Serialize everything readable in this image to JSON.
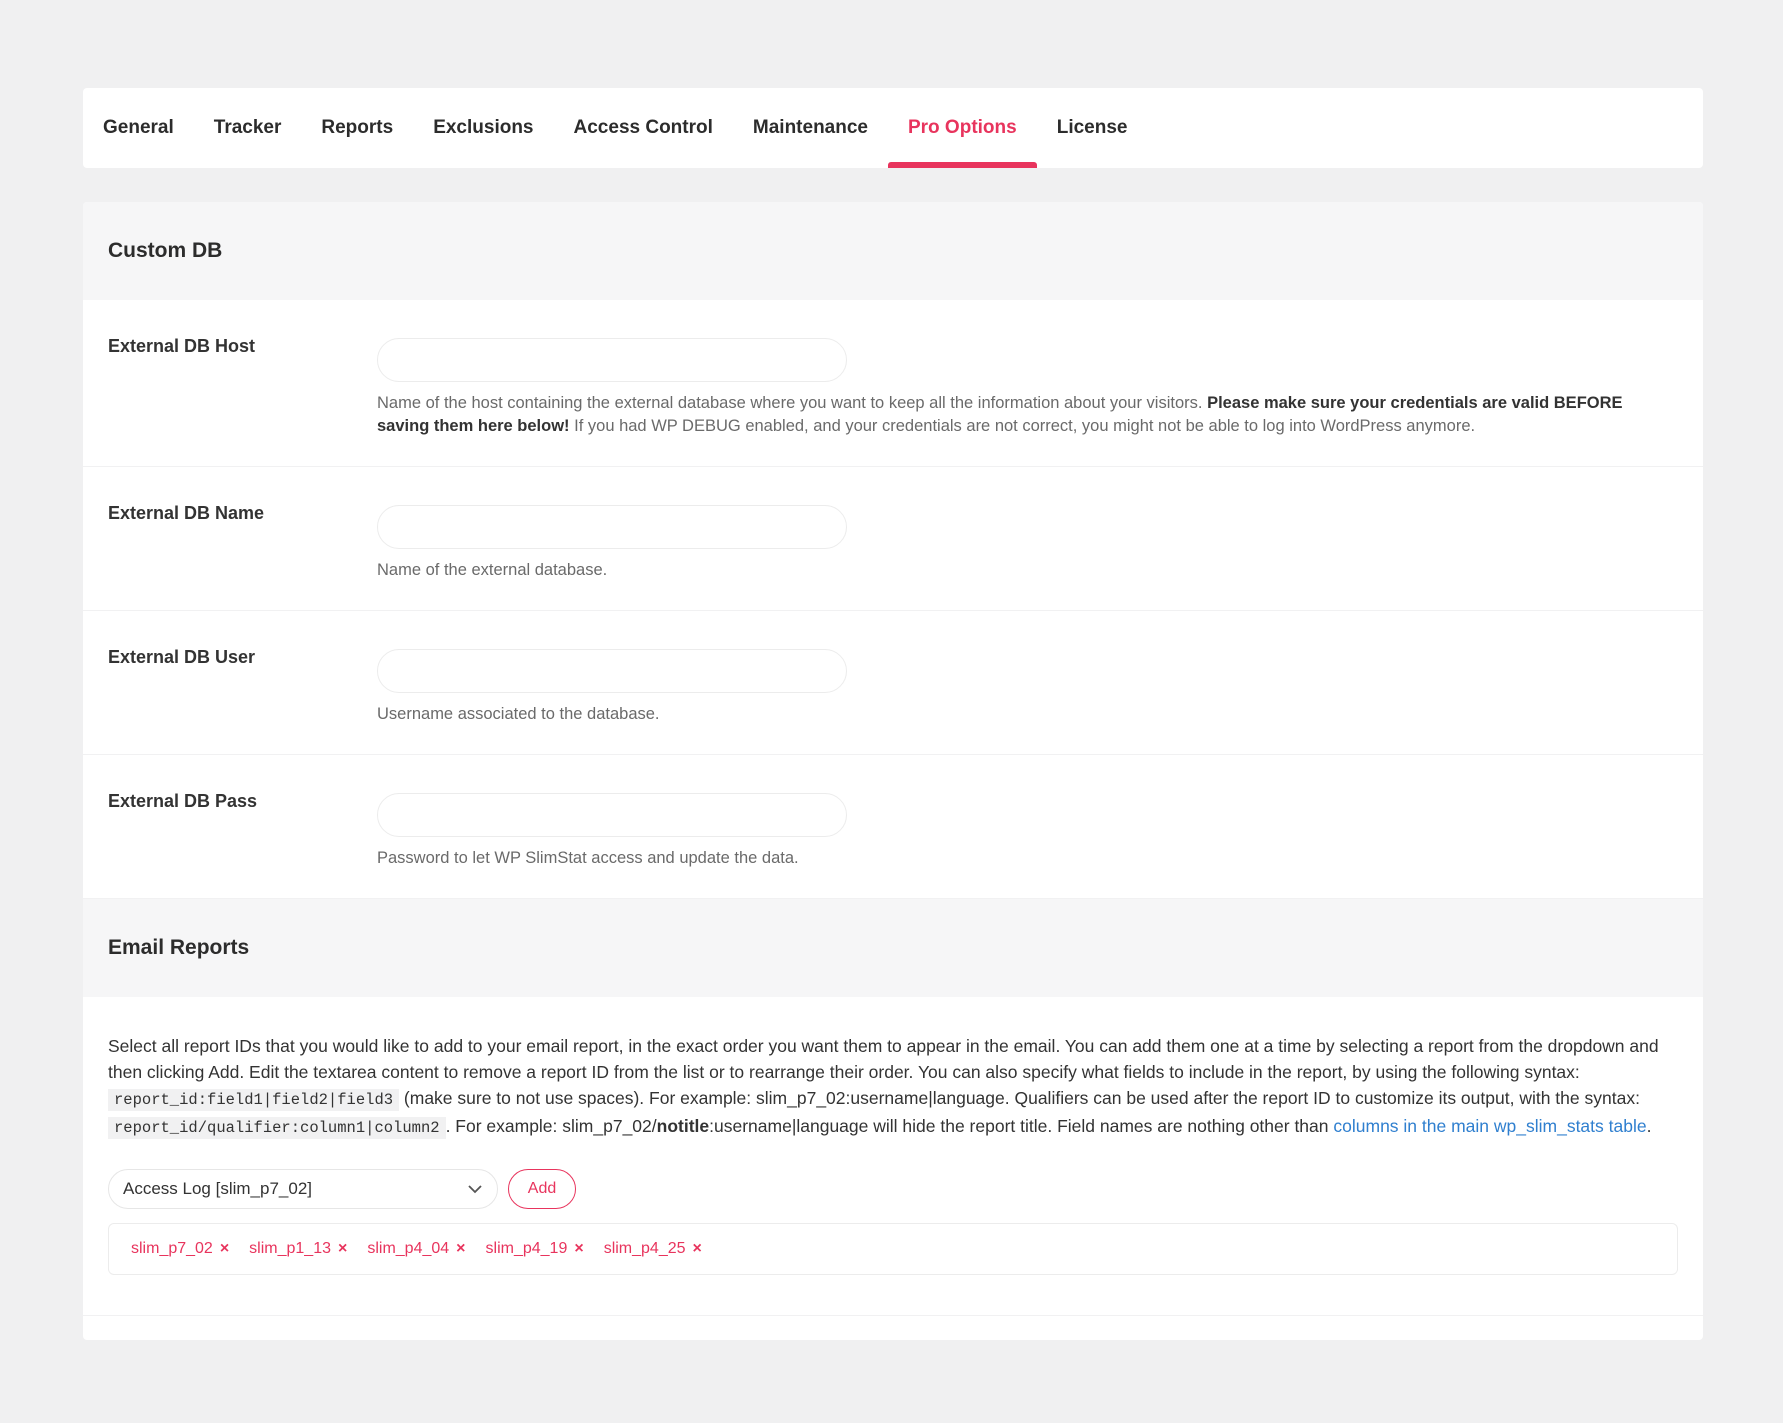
{
  "tabs": [
    {
      "label": "General"
    },
    {
      "label": "Tracker"
    },
    {
      "label": "Reports"
    },
    {
      "label": "Exclusions"
    },
    {
      "label": "Access Control"
    },
    {
      "label": "Maintenance"
    },
    {
      "label": "Pro Options"
    },
    {
      "label": "License"
    }
  ],
  "active_tab": "Pro Options",
  "colors": {
    "accent": "#e8345d",
    "link": "#2f7fcf",
    "background": "#f0f0f1"
  },
  "custom_db": {
    "title": "Custom DB",
    "host": {
      "label": "External DB Host",
      "value": "",
      "desc_pre": "Name of the host containing the external database where you want to keep all the information about your visitors.",
      "desc_bold": "Please make sure your credentials are valid BEFORE saving them here below!",
      "desc_post": "If you had WP DEBUG enabled, and your credentials are not correct, you might not be able to log into WordPress anymore."
    },
    "name": {
      "label": "External DB Name",
      "value": "",
      "desc": "Name of the external database."
    },
    "user": {
      "label": "External DB User",
      "value": "",
      "desc": "Username associated to the database."
    },
    "pass": {
      "label": "External DB Pass",
      "value": "",
      "desc": "Password to let WP SlimStat access and update the data."
    }
  },
  "email_reports": {
    "title": "Email Reports",
    "desc_1": "Select all report IDs that you would like to add to your email report, in the exact order you want them to appear in the email. You can add them one at a time by selecting a report from the dropdown and then clicking Add. Edit the textarea content to remove a report ID from the list or to rearrange their order. You can also specify what fields to include in the report, by using the following syntax:",
    "code_1": "report_id:field1|field2|field3",
    "desc_2": "(make sure to not use spaces). For example: slim_p7_02:username|language. Qualifiers can be used after the report ID to customize its output, with the syntax:",
    "code_2": "report_id/qualifier:column1|column2",
    "desc_3": ". For example: slim_p7_02/",
    "desc_bold": "notitle",
    "desc_4": ":username|language will hide the report title. Field names are nothing other than",
    "link_text": "columns in the main wp_slim_stats table",
    "desc_5": ".",
    "select_value": "Access Log [slim_p7_02]",
    "add_label": "Add",
    "tags": [
      {
        "label": "slim_p7_02"
      },
      {
        "label": "slim_p1_13"
      },
      {
        "label": "slim_p4_04"
      },
      {
        "label": "slim_p4_19"
      },
      {
        "label": "slim_p4_25"
      }
    ],
    "remove_glyph": "×"
  }
}
